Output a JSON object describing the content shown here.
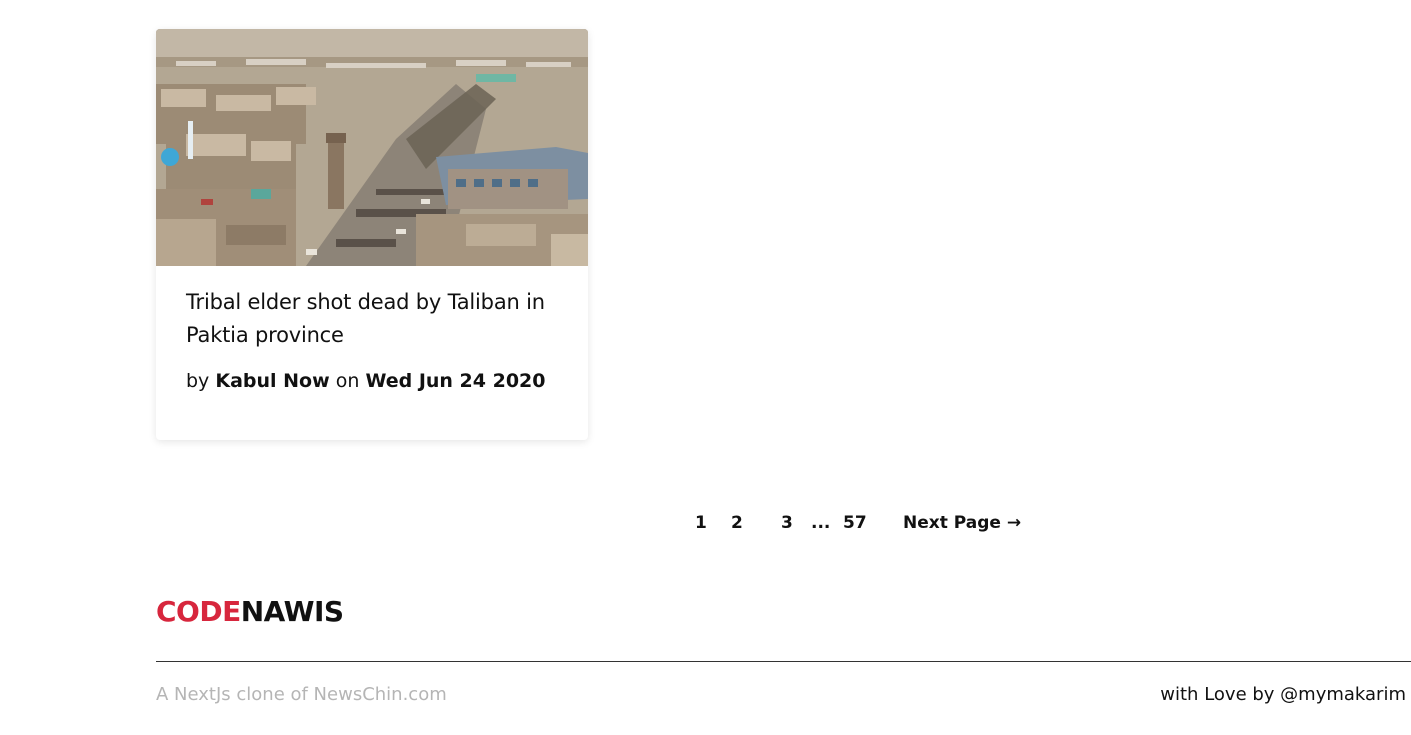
{
  "article": {
    "title": "Tribal elder shot dead by Taliban in Paktia province",
    "by_prefix": "by",
    "author": "Kabul Now",
    "on_text": "on",
    "date": "Wed Jun 24 2020"
  },
  "pagination": {
    "page_1": "1",
    "page_2": "2",
    "page_3": "3",
    "ellipsis": "...",
    "page_last": "57",
    "next_label": "Next Page →"
  },
  "footer": {
    "brand_part1": "CODE",
    "brand_part2": "NAWIS",
    "tagline": "A NextJs clone of NewsChin.com",
    "credit": "with Love by @mymakarim"
  },
  "colors": {
    "brand_accent": "#d7263d",
    "text": "#111111",
    "muted": "#b5b5b5"
  }
}
